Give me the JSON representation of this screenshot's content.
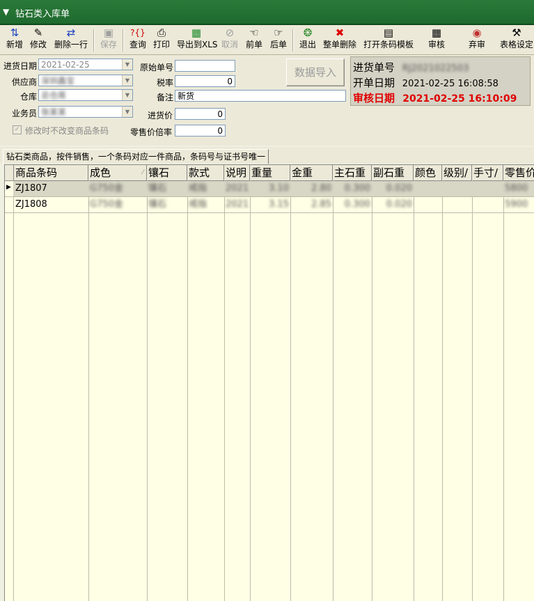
{
  "window": {
    "title": "钻石类入库单"
  },
  "toolbar": {
    "add": "新增",
    "edit": "修改",
    "delete_row": "删除一行",
    "save": "保存",
    "query": "查询",
    "print": "打印",
    "export_xls": "导出到XLS",
    "cancel": "取消",
    "prev": "前单",
    "next": "后单",
    "exit": "退出",
    "delete_all": "整单删除",
    "open_barcode_template": "打开条码模板",
    "audit": "审核",
    "abandon_audit": "弃审",
    "table_settings": "表格设定"
  },
  "form": {
    "date_label": "进货日期",
    "date_value": "2021-02-25",
    "supplier_label": "供应商",
    "supplier_value": "深圳鑫宝",
    "warehouse_label": "仓库",
    "warehouse_value": "总仓库",
    "clerk_label": "业务员",
    "clerk_value": "张某某",
    "original_no_label": "原始单号",
    "original_no_value": "",
    "tax_label": "税率",
    "tax_value": "0",
    "note_label": "备注",
    "note_value": "新货",
    "cost_label": "进货价",
    "cost_value": "0",
    "retail_rate_label": "零售价倍率",
    "retail_rate_value": "0",
    "keep_barcode_label": "修改时不改变商品条码",
    "import_button": "数据导入"
  },
  "info": {
    "order_no_label": "进货单号",
    "order_no_value": "RJ2021022503",
    "open_date_label": "开单日期",
    "open_date_value": "2021-02-25 16:08:58",
    "audit_date_label": "审核日期",
    "audit_date_value": "2021-02-25 16:10:09"
  },
  "tab": {
    "label": "钻石类商品，按件销售，一个条码对应一件商品，条码号与证书号唯一"
  },
  "grid": {
    "columns": [
      "商品条码",
      "成色",
      "镶石",
      "款式",
      "说明",
      "重量",
      "金重",
      "主石重",
      "副石重",
      "颜色",
      "级别/",
      "手寸/",
      "零售价"
    ],
    "rows": [
      [
        "ZJ1807",
        "G750金",
        "镶石",
        "戒指",
        "2021",
        "3.10",
        "2.80",
        "0.300",
        "0.020",
        "",
        "",
        "",
        "5800"
      ],
      [
        "ZJ1808",
        "G750金",
        "镶石",
        "戒指",
        "2021",
        "3.15",
        "2.85",
        "0.300",
        "0.020",
        "",
        "",
        "",
        "5900"
      ]
    ]
  },
  "colors": {
    "title_bar": "#1f6a2e",
    "audit_red": "#e00000",
    "grid_bg": "#ffffe6"
  }
}
